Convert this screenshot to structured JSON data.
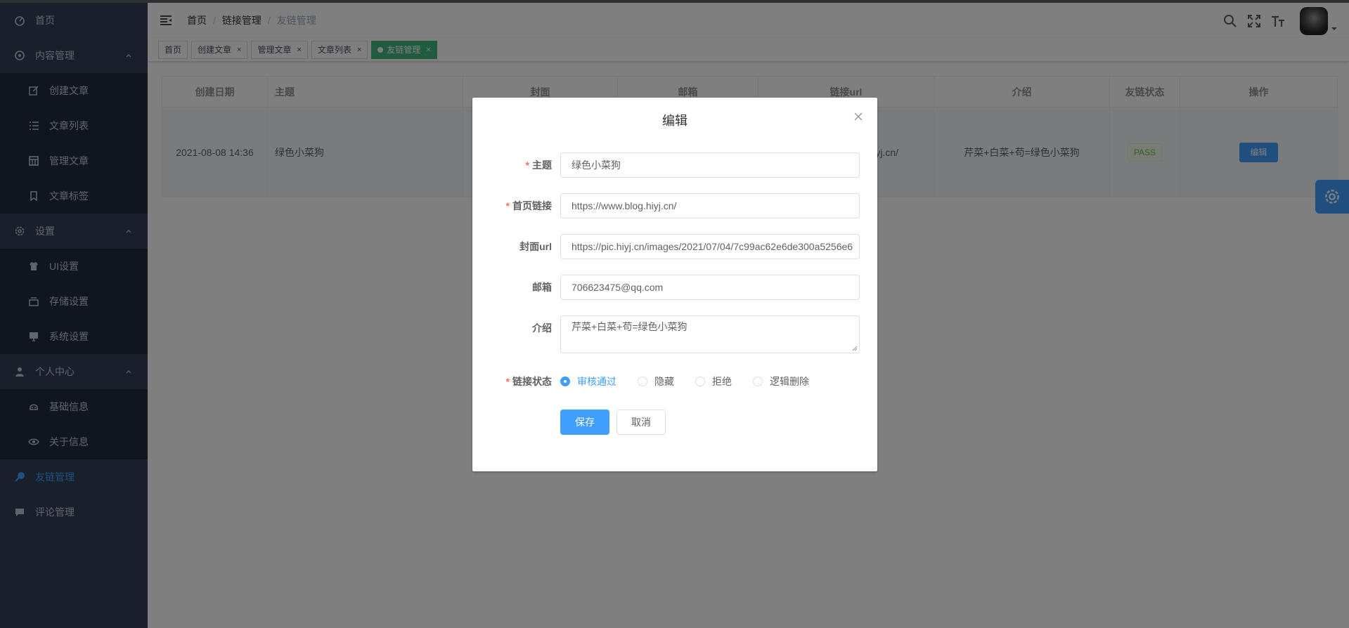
{
  "sidebar": {
    "items": [
      {
        "label": "首页",
        "icon": "dashboard-icon",
        "type": "top"
      },
      {
        "label": "内容管理",
        "icon": "content-icon",
        "type": "group"
      },
      {
        "label": "创建文章",
        "icon": "edit-icon",
        "type": "sub"
      },
      {
        "label": "文章列表",
        "icon": "list-icon",
        "type": "sub"
      },
      {
        "label": "管理文章",
        "icon": "table-icon",
        "type": "sub"
      },
      {
        "label": "文章标签",
        "icon": "bookmark-icon",
        "type": "sub"
      },
      {
        "label": "设置",
        "icon": "settings-icon",
        "type": "group"
      },
      {
        "label": "UI设置",
        "icon": "shirt-icon",
        "type": "sub"
      },
      {
        "label": "存储设置",
        "icon": "storage-icon",
        "type": "sub"
      },
      {
        "label": "系统设置",
        "icon": "monitor-icon",
        "type": "sub"
      },
      {
        "label": "个人中心",
        "icon": "user-icon",
        "type": "group"
      },
      {
        "label": "基础信息",
        "icon": "id-card-icon",
        "type": "sub"
      },
      {
        "label": "关于信息",
        "icon": "eye-icon",
        "type": "sub"
      },
      {
        "label": "友链管理",
        "icon": "link-icon",
        "type": "top",
        "active": true
      },
      {
        "label": "评论管理",
        "icon": "comment-icon",
        "type": "top"
      }
    ]
  },
  "breadcrumb": [
    "首页",
    "链接管理",
    "友链管理"
  ],
  "tags": [
    {
      "label": "首页",
      "closable": false
    },
    {
      "label": "创建文章",
      "closable": true
    },
    {
      "label": "管理文章",
      "closable": true
    },
    {
      "label": "文章列表",
      "closable": true
    },
    {
      "label": "友链管理",
      "closable": true,
      "active": true
    }
  ],
  "table": {
    "headers": [
      "创建日期",
      "主题",
      "封面",
      "邮箱",
      "链接url",
      "介绍",
      "友链状态",
      "操作"
    ],
    "row": {
      "date": "2021-08-08 14:36",
      "theme": "绿色小菜狗",
      "url_fragment": "yj.cn/",
      "intro": "芹菜+白菜+苟=绿色小菜狗",
      "status": "PASS",
      "action": "编辑"
    }
  },
  "dialog": {
    "title": "编辑",
    "fields": {
      "theme": {
        "label": "主题",
        "required": true,
        "value": "绿色小菜狗"
      },
      "home_link": {
        "label": "首页链接",
        "required": true,
        "value": "https://www.blog.hiyj.cn/"
      },
      "cover_url": {
        "label": "封面url",
        "required": false,
        "value": "https://pic.hiyj.cn/images/2021/07/04/7c99ac62e6de300a5256e6"
      },
      "email": {
        "label": "邮箱",
        "required": false,
        "value": "706623475@qq.com"
      },
      "intro": {
        "label": "介绍",
        "required": false,
        "value": "芹菜+白菜+苟=绿色小菜狗"
      },
      "status": {
        "label": "链接状态",
        "required": true,
        "options": [
          "审核通过",
          "隐藏",
          "拒绝",
          "逻辑删除"
        ],
        "selected": "审核通过"
      }
    },
    "save_label": "保存",
    "cancel_label": "取消",
    "required_mark": "*"
  },
  "colors": {
    "primary": "#409eff",
    "sidebar_bg": "#304156",
    "tag_active": "#42b983",
    "required": "#f56c6c"
  }
}
